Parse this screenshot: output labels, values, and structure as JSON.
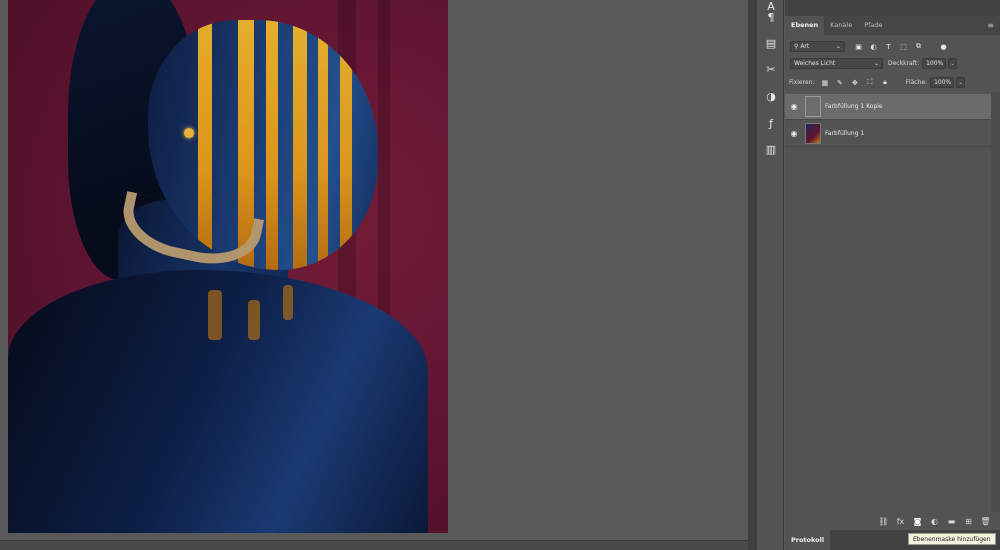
{
  "panel_tabs": [
    {
      "label": "Ebenen"
    },
    {
      "label": "Kanäle"
    },
    {
      "label": "Pfade"
    }
  ],
  "filter": {
    "kind": "Art"
  },
  "blend": {
    "mode": "Weiches Licht",
    "opacity_label": "Deckkraft:",
    "opacity_value": "100%"
  },
  "lock": {
    "label": "Fixieren:",
    "fill_label": "Fläche:",
    "fill_value": "100%"
  },
  "layers": [
    {
      "name": "Farbfüllung 1 Kopie",
      "selected": true
    },
    {
      "name": "Farbfüllung 1",
      "selected": false
    }
  ],
  "bottom_tab": "Protokoll",
  "tooltip": "Ebenenmaske hinzufügen",
  "colors": {
    "canvas_bg": "#5d1430",
    "accent_gold": "#f0b62a",
    "skin_blue": "#1b3c72"
  }
}
